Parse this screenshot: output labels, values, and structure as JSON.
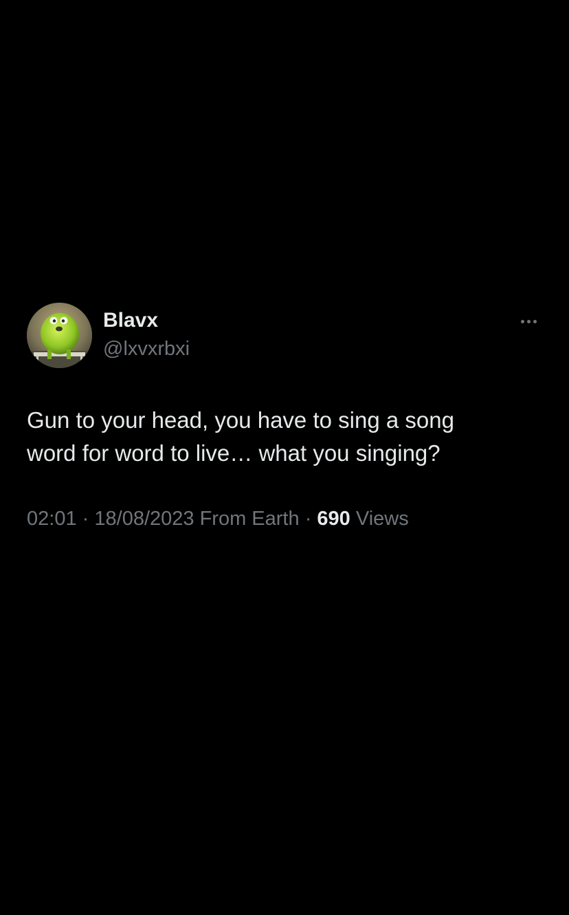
{
  "tweet": {
    "author": {
      "display_name": "Blavx",
      "handle": "@lxvxrbxi",
      "avatar_icon": "avatar-image"
    },
    "more_icon": "more-options-icon",
    "text_lines": [
      "Gun to your head, you have to sing a song",
      "word for word to live… what you singing?"
    ],
    "meta": {
      "time": "02:01",
      "separator_1": "·",
      "date": "18/08/2023",
      "source": "From Earth",
      "separator_2": "·",
      "views_count": "690",
      "views_label": "Views"
    }
  },
  "colors": {
    "background": "#000000",
    "primary_text": "#e7e9ea",
    "secondary_text": "#71767b"
  }
}
